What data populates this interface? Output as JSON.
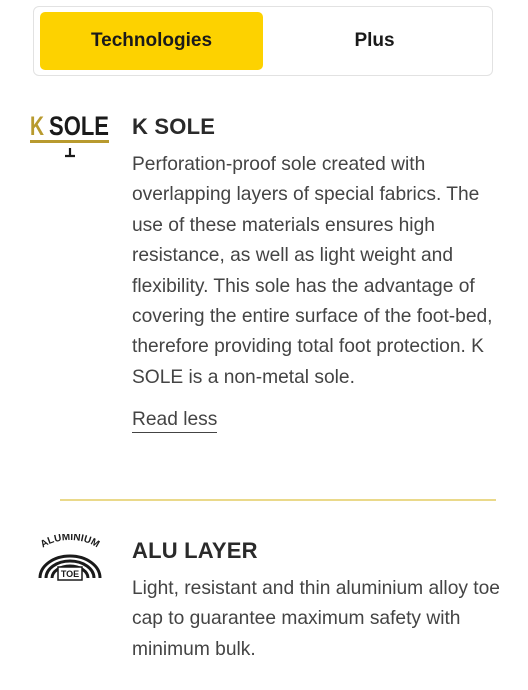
{
  "tabs": [
    {
      "label": "Technologies",
      "active": true
    },
    {
      "label": "Plus",
      "active": false
    }
  ],
  "features": [
    {
      "logo_text": "K SOLE",
      "logo_icon": "k-sole-logo",
      "title": "K SOLE",
      "description": "Perforation-proof sole created with overlapping layers of special fabrics. The use of these materials ensures high resistance, as well as light weight and flexibility. This sole has the advantage of covering the entire surface of the foot-bed, therefore providing total foot protection. K SOLE is a non-metal sole.",
      "read_less": "Read less"
    },
    {
      "logo_text": "ALUMINIUM TOE",
      "logo_arc_text": "ALUMINIUM",
      "logo_box_text": "TOE",
      "logo_icon": "aluminium-toe-logo",
      "title": "ALU LAYER",
      "description": "Light, resistant and thin aluminium alloy toe cap to guarantee maximum safety with minimum bulk."
    }
  ],
  "colors": {
    "accent": "#fdd200",
    "divider": "#ead98a",
    "logo_gold": "#b89a2e"
  }
}
